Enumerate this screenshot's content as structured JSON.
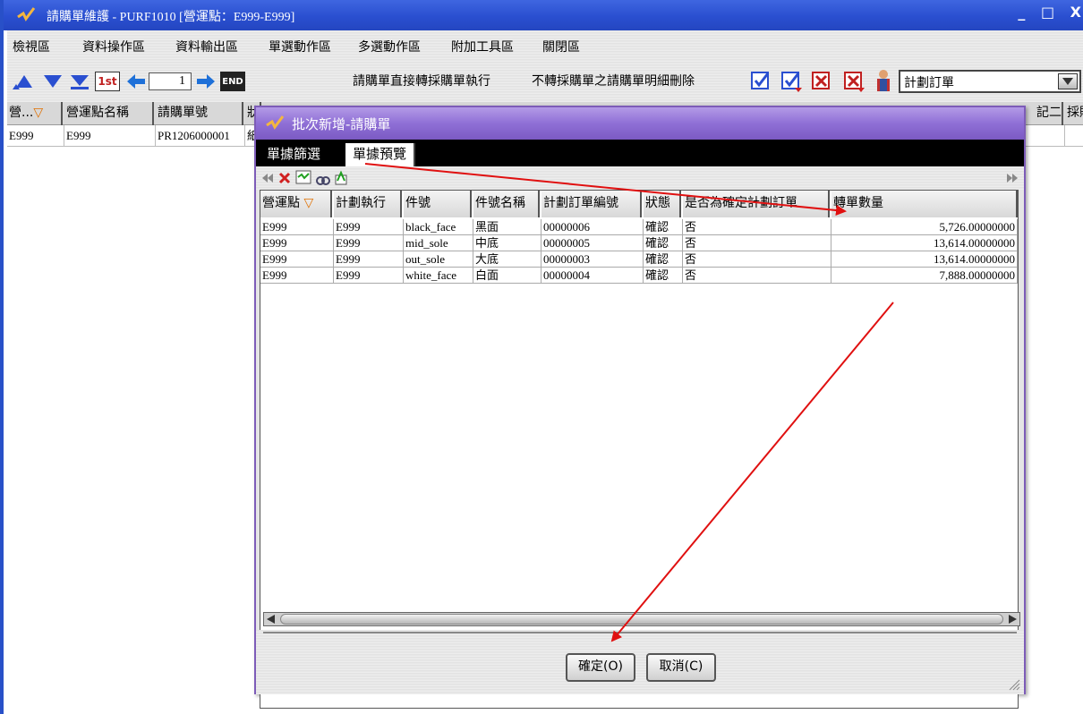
{
  "window": {
    "title": "請購單維護 - PURF1010 [營運點：E999-E999]",
    "buttons": "_ □ X"
  },
  "menu": [
    "檢視區",
    "資料輸出區",
    "資料操作區",
    "單選動作區",
    "多選動作區",
    "附加工具區",
    "關閉區"
  ],
  "toolbar": {
    "record_number": "1",
    "direct_convert_label": "請購單直接轉採購單執行",
    "delete_label": "不轉採購單之請購單明細刪除",
    "plan_select_value": "計劃訂單",
    "first_label": "1st",
    "end_label": "END"
  },
  "main_grid": {
    "headers": [
      "營...",
      "營運點名稱",
      "請購單號",
      "狀",
      "記二",
      "採購"
    ],
    "row": [
      "E999",
      "E999",
      "PR1206000001",
      "紙"
    ]
  },
  "dialog": {
    "title": "批次新增-請購單",
    "tabs": [
      "單據篩選",
      "單據預覽"
    ],
    "headers": [
      "營運點",
      "計劃執行",
      "件號",
      "件號名稱",
      "計劃訂單編號",
      "狀態",
      "是否為確定計劃訂單",
      "轉單數量"
    ],
    "rows": [
      [
        "E999",
        "E999",
        "black_face",
        "黑面",
        "00000006",
        "確認",
        "否",
        "5,726.00000000"
      ],
      [
        "E999",
        "E999",
        "mid_sole",
        "中底",
        "00000005",
        "確認",
        "否",
        "13,614.00000000"
      ],
      [
        "E999",
        "E999",
        "out_sole",
        "大底",
        "00000003",
        "確認",
        "否",
        "13,614.00000000"
      ],
      [
        "E999",
        "E999",
        "white_face",
        "白面",
        "00000004",
        "確認",
        "否",
        "7,888.00000000"
      ]
    ],
    "confirm_label": "確定(O)",
    "cancel_label": "取消(C)"
  },
  "colors": {
    "title_bar": "#2a4fd0",
    "dialog_title": "#8f6fd6",
    "annotation_arrow": "#e01010"
  }
}
